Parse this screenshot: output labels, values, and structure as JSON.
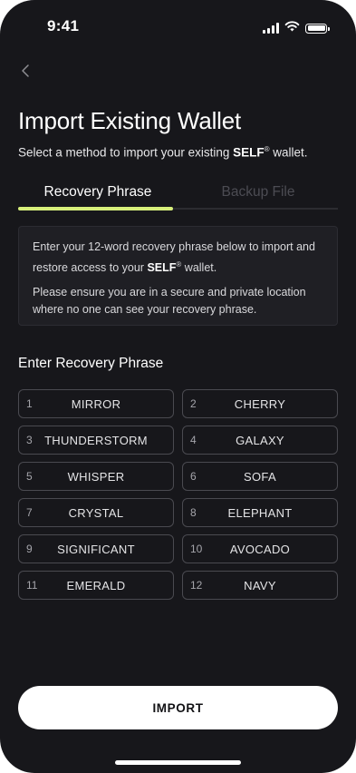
{
  "status_bar": {
    "time": "9:41",
    "icons": [
      "signal-icon",
      "wifi-icon",
      "battery-icon"
    ]
  },
  "navigation": {
    "back_icon": "chevron-left-icon"
  },
  "header": {
    "title": "Import Existing Wallet",
    "subtitle_prefix": "Select a method to import your existing ",
    "brand": "SELF",
    "registered": "®",
    "subtitle_suffix": " wallet."
  },
  "tabs": [
    {
      "label": "Recovery Phrase",
      "active": true
    },
    {
      "label": "Backup File",
      "active": false
    }
  ],
  "info": {
    "line1_prefix": "Enter your 12-word recovery phrase below to import and restore access to your ",
    "brand": "SELF",
    "registered": "®",
    "line1_suffix": " wallet.",
    "line2": "Please ensure you are in a secure and private location where no one can see your recovery phrase."
  },
  "recovery": {
    "section_title": "Enter Recovery Phrase",
    "words": [
      {
        "index": "1",
        "word": "MIRROR"
      },
      {
        "index": "2",
        "word": "CHERRY"
      },
      {
        "index": "3",
        "word": "THUNDERSTORM"
      },
      {
        "index": "4",
        "word": "GALAXY"
      },
      {
        "index": "5",
        "word": "WHISPER"
      },
      {
        "index": "6",
        "word": "SOFA"
      },
      {
        "index": "7",
        "word": "CRYSTAL"
      },
      {
        "index": "8",
        "word": "ELEPHANT"
      },
      {
        "index": "9",
        "word": "SIGNIFICANT"
      },
      {
        "index": "10",
        "word": "AVOCADO"
      },
      {
        "index": "11",
        "word": "EMERALD"
      },
      {
        "index": "12",
        "word": "NAVY"
      }
    ]
  },
  "actions": {
    "import_label": "IMPORT"
  },
  "colors": {
    "background": "#17171b",
    "accent": "#d7ef7b",
    "inactive_tab": "#4c4c53",
    "card": "#1f1f24"
  }
}
